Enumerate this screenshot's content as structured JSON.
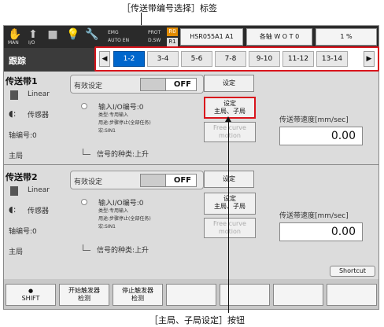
{
  "annotations": {
    "top_label": "［传送带编号选择］标签",
    "bottom_label": "［主局、子局设定］按钮"
  },
  "topbar": {
    "icons": [
      "hand-icon",
      "io-icon",
      "stop-icon",
      "bulb-icon",
      "wrench-icon"
    ],
    "small_labels": [
      "MAN",
      "I/O"
    ],
    "emg_lines": [
      "EMG",
      "AUTO EN"
    ],
    "prot_lines": [
      "PROT",
      "D.SW"
    ],
    "r0": "R0",
    "r1": "R1",
    "robot": "HSR055A1 A1",
    "axis": "各轴 W O T 0",
    "speed": "1 %"
  },
  "header": {
    "title": "跟踪",
    "tabs": [
      "1-2",
      "3-4",
      "5-6",
      "7-8",
      "9-10",
      "11-12",
      "13-14"
    ],
    "active_tab": 0
  },
  "sections": [
    {
      "title": "传送带1",
      "type": "Linear",
      "sensor_label": "传感器",
      "axis_label": "轴编号:0",
      "master_label": "主局",
      "enable_label": "有效设定",
      "enable_value": "OFF",
      "setting_btn": "设定",
      "io_label": "输入I/O编号:0",
      "io_details": [
        "类型:专用输入",
        "用途:步骤停止(全部任务)",
        "宏:SIN1"
      ],
      "master_btn": "设定\n主局、子局",
      "free_btn": "Free curve\nmotion",
      "signal_label": "信号的种类:上升",
      "speed_label": "传送带速度[mm/sec]",
      "speed_value": "0.00"
    },
    {
      "title": "传送带2",
      "type": "Linear",
      "sensor_label": "传感器",
      "axis_label": "轴编号:0",
      "master_label": "主局",
      "enable_label": "有效设定",
      "enable_value": "OFF",
      "setting_btn": "设定",
      "io_label": "输入I/O编号:0",
      "io_details": [
        "类型:专用输入",
        "用途:步骤停止(全部任务)",
        "宏:SIN1"
      ],
      "master_btn": "设定\n主局、子局",
      "free_btn": "Free curve\nmotion",
      "signal_label": "信号的种类:上升",
      "speed_label": "传送带速度[mm/sec]",
      "speed_value": "0.00"
    }
  ],
  "shortcut": "Shortcut",
  "footer": {
    "buttons": [
      "SHIFT",
      "开始触发器\n检测",
      "停止触发器\n检测",
      "",
      "",
      "",
      ""
    ]
  },
  "colors": {
    "accent": "#0066cc",
    "highlight": "#d9141c"
  }
}
